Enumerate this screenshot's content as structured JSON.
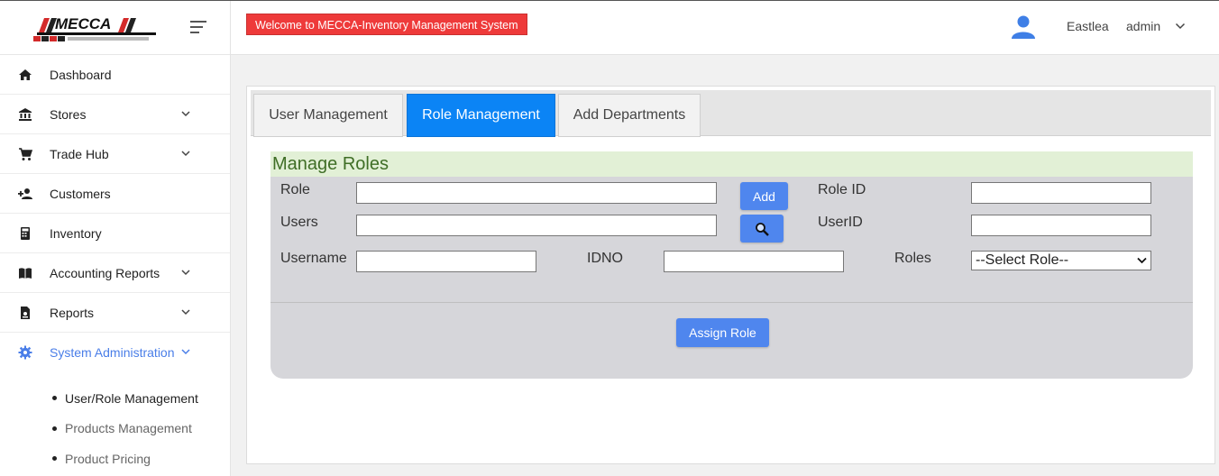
{
  "header": {
    "welcome": "Welcome to MECCA-Inventory Management System",
    "branch": "Eastlea",
    "username": "admin"
  },
  "sidebar": {
    "items": [
      {
        "label": "Dashboard",
        "icon": "home-icon"
      },
      {
        "label": "Stores",
        "icon": "bank-icon",
        "expandable": true
      },
      {
        "label": "Trade Hub",
        "icon": "cart-icon",
        "expandable": true
      },
      {
        "label": "Customers",
        "icon": "person-add-icon"
      },
      {
        "label": "Inventory",
        "icon": "calculator-icon"
      },
      {
        "label": "Accounting Reports",
        "icon": "book-icon",
        "expandable": true
      },
      {
        "label": "Reports",
        "icon": "report-icon",
        "expandable": true
      },
      {
        "label": "System Administration",
        "icon": "gear-icon",
        "expandable": true,
        "active": true
      }
    ],
    "subitems": [
      {
        "label": "User/Role Management",
        "current": true
      },
      {
        "label": "Products Management"
      },
      {
        "label": "Product Pricing"
      }
    ]
  },
  "tabs": [
    {
      "label": "User Management"
    },
    {
      "label": "Role Management",
      "active": true
    },
    {
      "label": "Add Departments"
    }
  ],
  "form": {
    "title": "Manage Roles",
    "role_label": "Role",
    "role_value": "",
    "add_button": "Add",
    "role_id_label": "Role ID",
    "role_id_value": "",
    "users_label": "Users",
    "users_value": "",
    "user_id_label": "UserID",
    "user_id_value": "",
    "username_label": "Username",
    "username_value": "",
    "idno_label": "IDNO",
    "idno_value": "",
    "roles_label": "Roles",
    "roles_selected": "--Select Role--",
    "assign_button": "Assign Role"
  },
  "colors": {
    "accent": "#4f86ee",
    "active_tab": "#0b84f5",
    "welcome_bg": "#ee3a3a",
    "title_bg": "#e2f0d6",
    "title_text": "#3f6e26",
    "active_nav": "#4a7ee8"
  }
}
